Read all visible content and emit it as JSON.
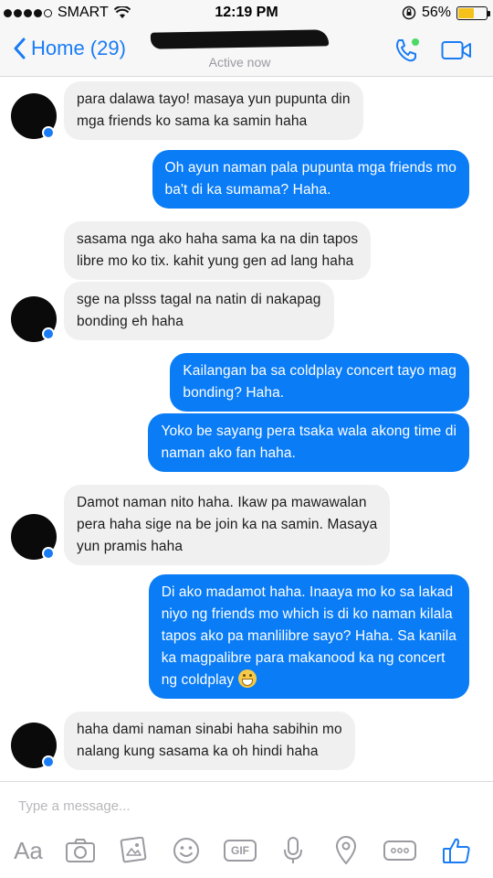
{
  "status_bar": {
    "carrier": "SMART",
    "time": "12:19 PM",
    "battery": "56%",
    "battery_level": 0.56
  },
  "header": {
    "back_label": "Home (29)",
    "presence": "Active now"
  },
  "messages": [
    {
      "side": "in",
      "lines": [
        "para dalawa tayo! masaya yun pupunta din",
        "mga friends ko sama ka samin haha"
      ]
    },
    {
      "side": "out",
      "lines": [
        "Oh ayun naman pala pupunta mga friends mo",
        "ba't di ka sumama? Haha."
      ]
    },
    {
      "side": "in",
      "lines": [
        "sasama nga ako haha sama ka na din tapos",
        "libre mo ko tix. kahit yung gen ad lang haha"
      ]
    },
    {
      "side": "in",
      "lines": [
        "sge na plsss tagal na natin di nakapag",
        "bonding eh haha"
      ]
    },
    {
      "side": "out",
      "lines": [
        "Kailangan ba sa coldplay concert tayo mag",
        "bonding? Haha."
      ]
    },
    {
      "side": "out",
      "lines": [
        "Yoko be sayang pera tsaka wala akong time di",
        "naman ako fan haha."
      ]
    },
    {
      "side": "in",
      "lines": [
        "Damot naman nito haha. Ikaw pa mawawalan",
        "pera haha sige na be join ka na samin. Masaya",
        "yun pramis haha"
      ]
    },
    {
      "side": "out",
      "lines": [
        "Di ako madamot haha. Inaaya mo ko sa lakad",
        "niyo ng friends mo which is di ko naman kilala",
        "tapos ako pa manlilibre sayo? Haha. Sa kanila",
        "ka magpalibre para makanood ka ng concert",
        "ng coldplay"
      ],
      "emoji": "grinning-face"
    },
    {
      "side": "in",
      "lines": [
        "haha dami naman sinabi haha sabihin mo",
        "nalang kung sasama ka oh hindi haha"
      ]
    }
  ],
  "composer": {
    "placeholder": "Type a message...",
    "text_button": "Aa",
    "gif_label": "GIF"
  },
  "colors": {
    "accent": "#0a7cf6",
    "incoming_bubble": "#f1f0f0",
    "icon_gray": "#9a9aa0"
  }
}
